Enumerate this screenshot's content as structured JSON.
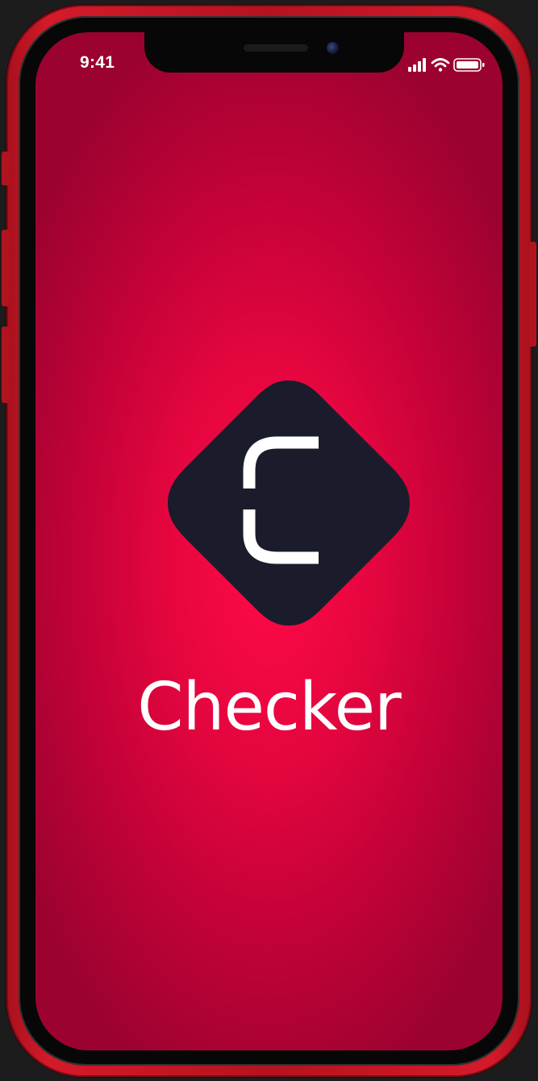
{
  "status_bar": {
    "time": "9:41",
    "icons": [
      "cellular-signal-icon",
      "wifi-icon",
      "battery-icon"
    ]
  },
  "splash": {
    "logo_letter": "C",
    "app_name": "Checker"
  },
  "colors": {
    "frame_red": "#c8121f",
    "screen_center": "#ff0a48",
    "screen_edge": "#9c0230",
    "logo_bg": "#1a1c2b",
    "text": "#ffffff"
  }
}
